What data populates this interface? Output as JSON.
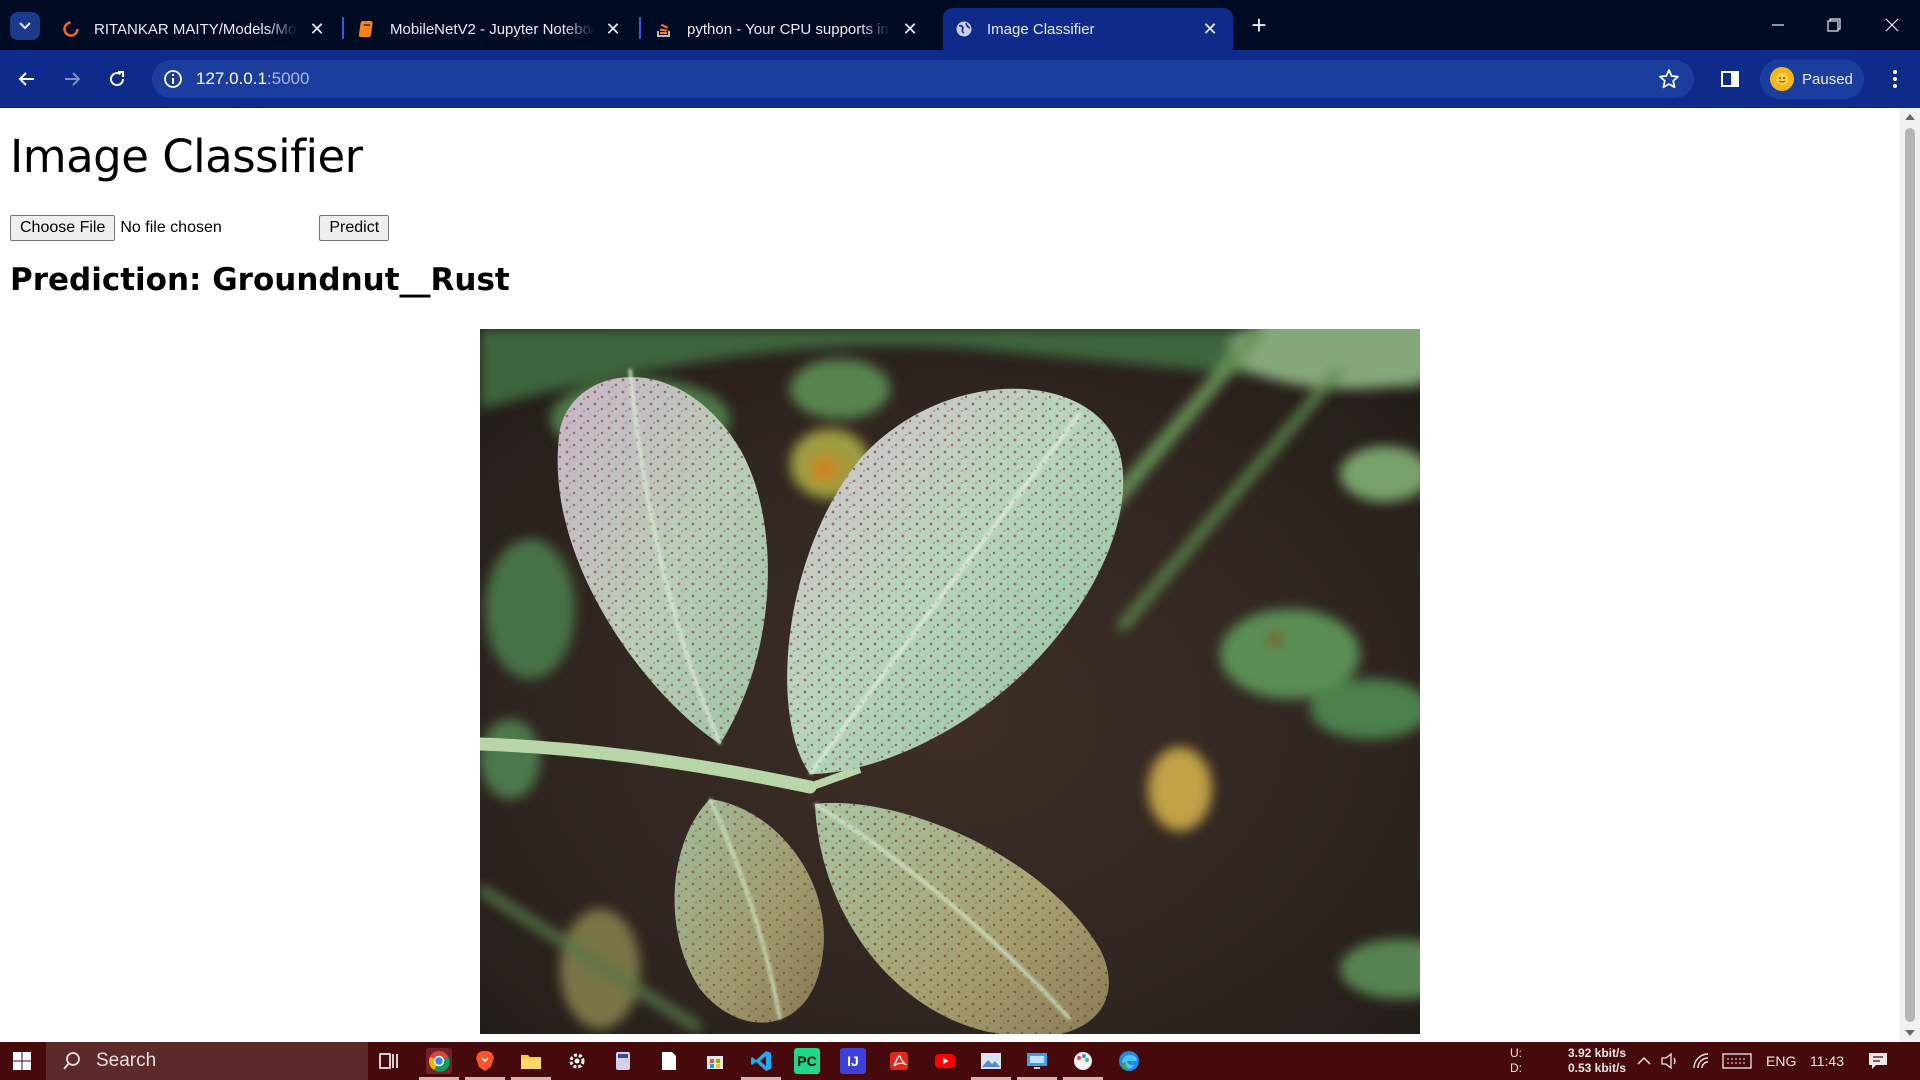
{
  "browser": {
    "tabs": [
      {
        "title": "RITANKAR MAITY/Models/Mob",
        "icon": "orange-ring-icon",
        "active": false
      },
      {
        "title": "MobileNetV2 - Jupyter Noteboo",
        "icon": "notebook-icon",
        "active": false
      },
      {
        "title": "python - Your CPU supports ins",
        "icon": "stack-overflow-icon",
        "active": false
      },
      {
        "title": "Image Classifier",
        "icon": "globe-icon",
        "active": true
      }
    ],
    "url_host": "127.0.0.1",
    "url_port": ":5000",
    "profile_label": "Paused"
  },
  "page": {
    "heading": "Image Classifier",
    "choose_file_label": "Choose File",
    "no_file_text": "No file chosen",
    "predict_label": "Predict",
    "prediction_text": "Prediction: Groundnut__Rust"
  },
  "taskbar": {
    "search_label": "Search",
    "upload_label": "U:",
    "download_label": "D:",
    "upload_speed": "3.92 kbit/s",
    "download_speed": "0.53 kbit/s",
    "language": "ENG",
    "time": "11:43"
  },
  "colors": {
    "titlebar_bg": "#020b24",
    "toolbar_bg": "#0e2a8a",
    "taskbar_bg": "#46090c"
  }
}
